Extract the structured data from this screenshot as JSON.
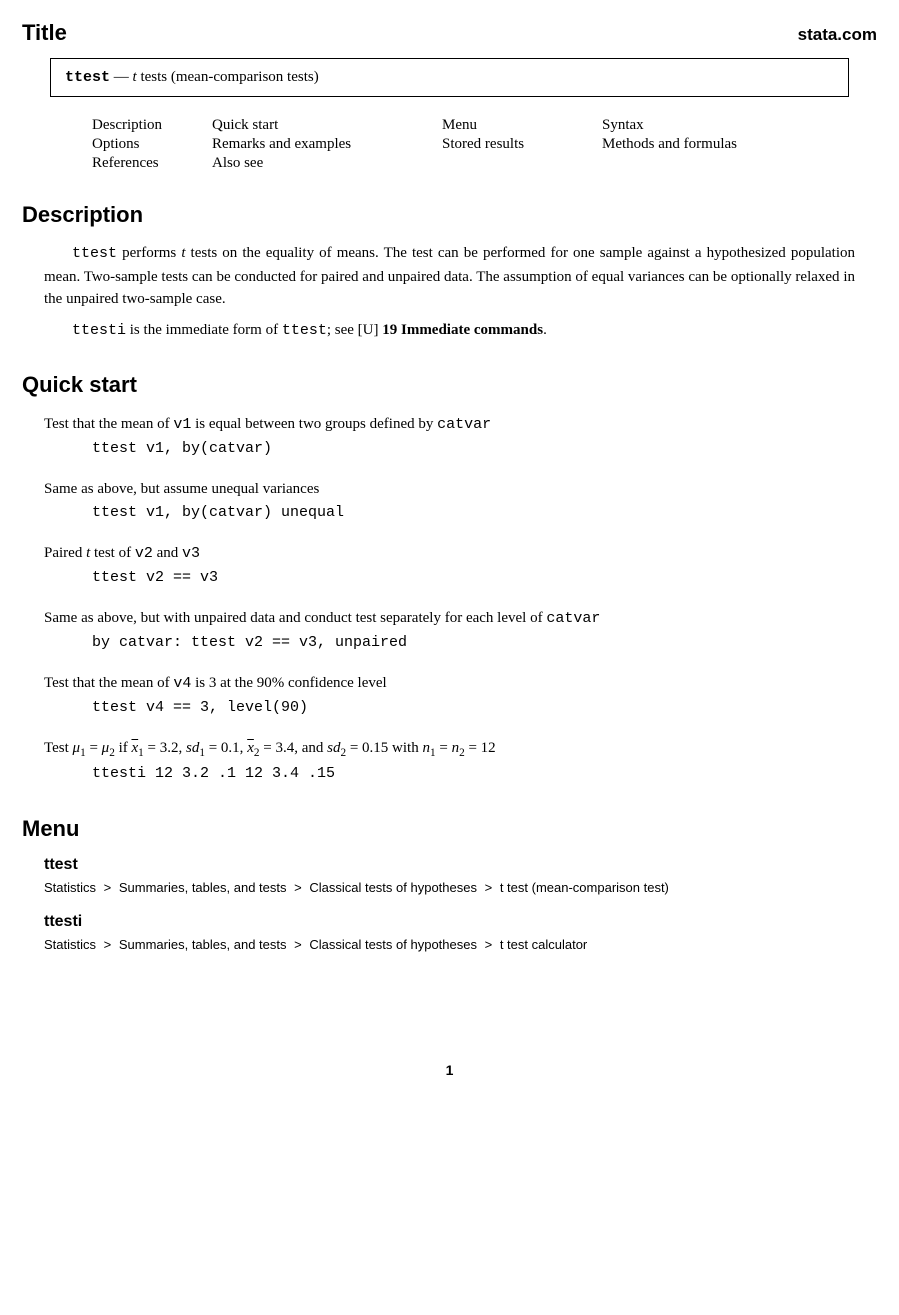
{
  "header": {
    "title": "Title",
    "brand": "stata.com"
  },
  "titlebox": {
    "cmd": "ttest",
    "dash": " — ",
    "it_t": "t",
    "rest": " tests (mean-comparison tests)"
  },
  "toc": {
    "r1c1": "Description",
    "r1c2": "Quick start",
    "r1c3": "Menu",
    "r1c4": "Syntax",
    "r2c1": "Options",
    "r2c2": "Remarks and examples",
    "r2c3": "Stored results",
    "r2c4": "Methods and formulas",
    "r3c1": "References",
    "r3c2": "Also see"
  },
  "sections": {
    "description": "Description",
    "quickstart": "Quick start",
    "menu": "Menu"
  },
  "desc": {
    "p1_cmd": "ttest",
    "p1_a": " performs ",
    "p1_t": "t",
    "p1_b": " tests on the equality of means. The test can be performed for one sample against a hypothesized population mean. Two-sample tests can be conducted for paired and unpaired data. The assumption of equal variances can be optionally relaxed in the unpaired two-sample case.",
    "p2_cmd1": "ttesti",
    "p2_a": " is the immediate form of ",
    "p2_cmd2": "ttest",
    "p2_b": "; see ",
    "p2_ref_bracket": "[U]",
    "p2_ref": " 19 Immediate commands",
    "p2_c": "."
  },
  "qs": {
    "i1_a": "Test that the mean of ",
    "i1_v1": "v1",
    "i1_b": " is equal between two groups defined by ",
    "i1_cv": "catvar",
    "i1_code": "ttest v1, by(catvar)",
    "i2_a": "Same as above, but assume unequal variances",
    "i2_code": "ttest v1, by(catvar) unequal",
    "i3_a": "Paired ",
    "i3_t": "t",
    "i3_b": " test of ",
    "i3_v2": "v2",
    "i3_c": " and ",
    "i3_v3": "v3",
    "i3_code": "ttest v2 == v3",
    "i4_a": "Same as above, but with unpaired data and conduct test separately for each level of ",
    "i4_cv": "catvar",
    "i4_code": "by catvar: ttest v2 == v3, unpaired",
    "i5_a": "Test that the mean of ",
    "i5_v4": "v4",
    "i5_b": " is 3 at the 90% confidence level",
    "i5_code": "ttest v4 == 3, level(90)",
    "i6_a": "Test ",
    "i6_mu1": "μ",
    "i6_s1": "1",
    "i6_eq": " = ",
    "i6_mu2": "μ",
    "i6_s2": "2",
    "i6_b": " if ",
    "i6_xbar1": "x",
    "i6_xb1s": "1",
    "i6_xb1v": " = 3.2, ",
    "i6_sd1": "sd",
    "i6_sd1s": "1",
    "i6_sd1v": " = 0.1, ",
    "i6_xbar2": "x",
    "i6_xb2s": "2",
    "i6_xb2v": " = 3.4, and ",
    "i6_sd2": "sd",
    "i6_sd2s": "2",
    "i6_sd2v": " = 0.15 with ",
    "i6_n1": "n",
    "i6_n1s": "1",
    "i6_n2": "n",
    "i6_n2s": "2",
    "i6_nv": " = 12",
    "i6_code": "ttesti 12 3.2 .1 12 3.4 .15"
  },
  "menu": {
    "sub1": "ttest",
    "path1_a": "Statistics",
    "path1_b": "Summaries, tables, and tests",
    "path1_c": "Classical tests of hypotheses",
    "path1_d": "t test (mean-comparison test)",
    "sub2": "ttesti",
    "path2_a": "Statistics",
    "path2_b": "Summaries, tables, and tests",
    "path2_c": "Classical tests of hypotheses",
    "path2_d": "t test calculator",
    "gt": ">"
  },
  "pagenum": "1"
}
